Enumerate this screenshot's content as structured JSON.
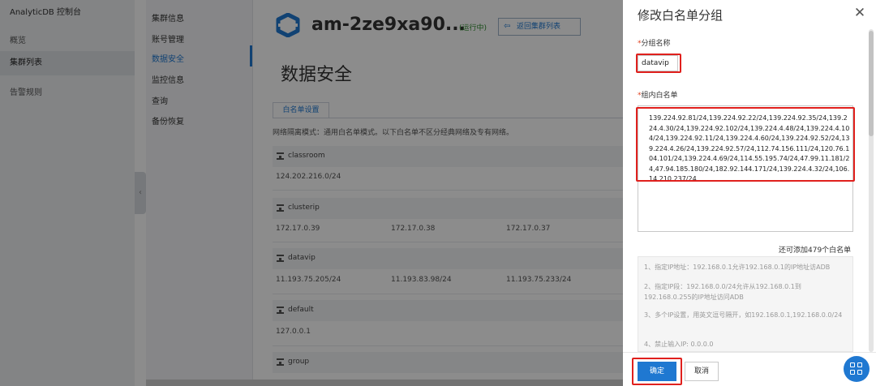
{
  "left_nav": {
    "brand": "AnalyticDB 控制台",
    "items": [
      {
        "label": "概览",
        "active": false
      },
      {
        "label": "集群列表",
        "active": true
      },
      {
        "label": "告警规则",
        "active": false
      }
    ]
  },
  "sub_nav": {
    "items": [
      {
        "label": "集群信息",
        "active": false
      },
      {
        "label": "账号管理",
        "active": false
      },
      {
        "label": "数据安全",
        "active": true
      },
      {
        "label": "监控信息",
        "active": false
      },
      {
        "label": "查询",
        "active": false
      },
      {
        "label": "备份恢复",
        "active": false
      }
    ]
  },
  "content": {
    "cluster_name": "am-2ze9xa90...",
    "cluster_status": "(运行中)",
    "back_label": "返回集群列表",
    "page_title": "数据安全",
    "tab_label": "白名单设置",
    "description": "网络隔离模式：通用白名单模式。以下白名单不区分经典网络及专有网络。",
    "groups": [
      {
        "name": "classroom",
        "ips": [
          "124.202.216.0/24"
        ]
      },
      {
        "name": "clusterip",
        "ips": [
          "172.17.0.39",
          "172.17.0.38",
          "172.17.0.37"
        ]
      },
      {
        "name": "datavip",
        "ips": [
          "11.193.75.205/24",
          "11.193.83.98/24",
          "11.193.75.233/24"
        ]
      },
      {
        "name": "default",
        "ips": [
          "127.0.0.1"
        ]
      },
      {
        "name": "group",
        "ips": []
      }
    ]
  },
  "dialog": {
    "title": "修改白名单分组",
    "group_name_label": "分组名称",
    "group_name_value": "datavip",
    "whitelist_label": "组内白名单",
    "whitelist_value": "139.224.92.81/24,139.224.92.22/24,139.224.92.35/24,139.224.4.30/24,139.224.92.102/24,139.224.4.48/24,139.224.4.104/24,139.224.92.11/24,139.224.4.60/24,139.224.92.52/24,139.224.4.26/24,139.224.92.57/24,112.74.156.111/24,120.76.104.101/24,139.224.4.69/24,114.55.195.74/24,47.99.11.181/24,47.94.185.180/24,182.92.144.171/24,139.224.4.32/24,106.14.210.237/24",
    "remaining": "还可添加479个白名单",
    "tips": [
      "1、指定IP地址：192.168.0.1允许192.168.0.1的IP地址访ADB",
      "2、指定IP段：192.168.0.0/24允许从192.168.0.1到192.168.0.255的IP地址访问ADB",
      "3、多个IP设置，用英文逗号隔开，如192.168.0.1,192.168.0.0/24",
      "4、禁止输入IP: 0.0.0.0"
    ],
    "confirm_label": "确定",
    "cancel_label": "取消"
  },
  "colors": {
    "accent": "#1f78d1",
    "highlight": "#e0201d",
    "required": "#e0411f"
  }
}
